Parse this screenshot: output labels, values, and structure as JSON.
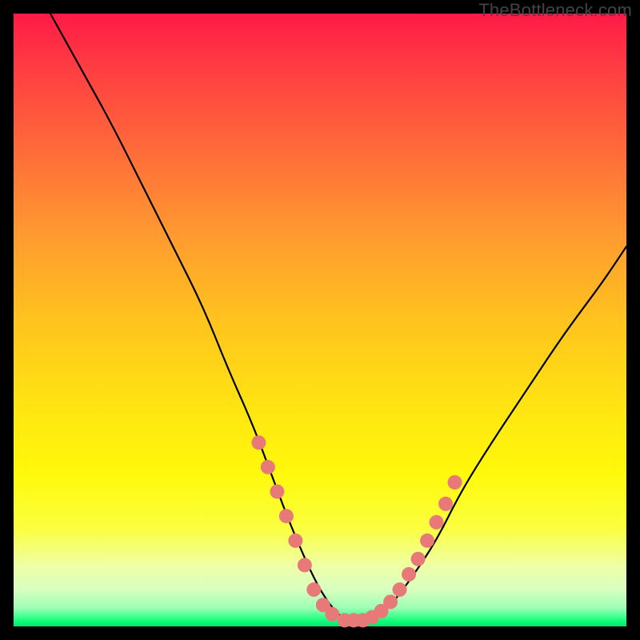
{
  "watermark": "TheBottleneck.com",
  "colors": {
    "curve_stroke": "#000000",
    "marker_fill": "#e77a78",
    "gradient_top": "#ff1a47",
    "gradient_bottom": "#02e56d",
    "background": "#000000"
  },
  "chart_data": {
    "type": "line",
    "title": "",
    "xlabel": "",
    "ylabel": "",
    "xlim": [
      0,
      100
    ],
    "ylim": [
      0,
      100
    ],
    "grid": false,
    "legend": false,
    "series": [
      {
        "name": "bottleneck-curve",
        "x": [
          6,
          11,
          16,
          21,
          26,
          31,
          35,
          39,
          42,
          45,
          48,
          50,
          52,
          54,
          56,
          58,
          60,
          62,
          65,
          69,
          73,
          78,
          84,
          90,
          96,
          100
        ],
        "values": [
          100,
          91,
          82,
          72,
          62,
          52,
          42,
          33,
          25,
          17,
          10,
          6,
          3,
          1,
          1,
          1,
          2,
          4,
          8,
          14,
          22,
          30,
          39,
          48,
          56,
          62
        ]
      }
    ],
    "markers": {
      "name": "highlighted-points",
      "color": "#e77a78",
      "points": [
        {
          "x": 40,
          "y": 30
        },
        {
          "x": 41.5,
          "y": 26
        },
        {
          "x": 43,
          "y": 22
        },
        {
          "x": 44.5,
          "y": 18
        },
        {
          "x": 46,
          "y": 14
        },
        {
          "x": 47.5,
          "y": 10
        },
        {
          "x": 49,
          "y": 6
        },
        {
          "x": 50.5,
          "y": 3.5
        },
        {
          "x": 52,
          "y": 2
        },
        {
          "x": 54,
          "y": 1
        },
        {
          "x": 55.5,
          "y": 1
        },
        {
          "x": 57,
          "y": 1
        },
        {
          "x": 58.5,
          "y": 1.5
        },
        {
          "x": 60,
          "y": 2.5
        },
        {
          "x": 61.5,
          "y": 4
        },
        {
          "x": 63,
          "y": 6
        },
        {
          "x": 64.5,
          "y": 8.5
        },
        {
          "x": 66,
          "y": 11
        },
        {
          "x": 67.5,
          "y": 14
        },
        {
          "x": 69,
          "y": 17
        },
        {
          "x": 70.5,
          "y": 20
        },
        {
          "x": 72,
          "y": 23.5
        }
      ]
    }
  }
}
